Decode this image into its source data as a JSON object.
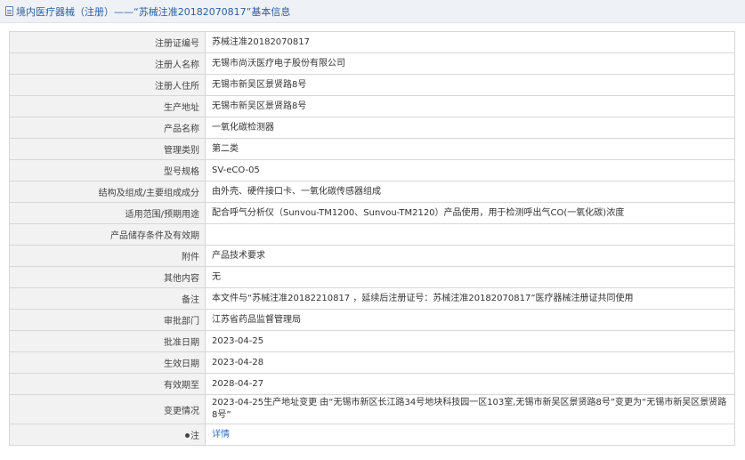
{
  "header": {
    "title": "境内医疗器械（注册）——“苏械注准20182070817”基本信息"
  },
  "rows": [
    {
      "label": "注册证编号",
      "value": "苏械注准20182070817"
    },
    {
      "label": "注册人名称",
      "value": "无锡市尚沃医疗电子股份有限公司"
    },
    {
      "label": "注册人住所",
      "value": "无锡市新吴区景贤路8号"
    },
    {
      "label": "生产地址",
      "value": "无锡市新吴区景贤路8号"
    },
    {
      "label": "产品名称",
      "value": "一氧化碳检测器"
    },
    {
      "label": "管理类别",
      "value": "第二类"
    },
    {
      "label": "型号规格",
      "value": "SV-eCO-05"
    },
    {
      "label": "结构及组成/主要组成成分",
      "value": "由外壳、硬件接口卡、一氧化碳传感器组成"
    },
    {
      "label": "适用范围/预期用途",
      "value": "配合呼气分析仪（Sunvou-TM1200、Sunvou-TM2120）产品使用，用于检测呼出气CO(一氧化碳)浓度"
    },
    {
      "label": "产品储存条件及有效期",
      "value": ""
    },
    {
      "label": "附件",
      "value": "产品技术要求"
    },
    {
      "label": "其他内容",
      "value": "无"
    },
    {
      "label": "备注",
      "value": "本文件与“苏械注准20182210817 ，延续后注册证号：苏械注准20182070817”医疗器械注册证共同使用"
    },
    {
      "label": "审批部门",
      "value": "江苏省药品监督管理局"
    },
    {
      "label": "批准日期",
      "value": "2023-04-25"
    },
    {
      "label": "生效日期",
      "value": "2023-04-28"
    },
    {
      "label": "有效期至",
      "value": "2028-04-27"
    },
    {
      "label": "变更情况",
      "value": "2023-04-25生产地址变更 由“无锡市新区长江路34号地块科技园一区103室,无锡市新吴区景贤路8号”变更为“无锡市新吴区景贤路8号”"
    }
  ],
  "note": {
    "label": "注",
    "icon": "pin-icon",
    "link_text": "详情"
  }
}
